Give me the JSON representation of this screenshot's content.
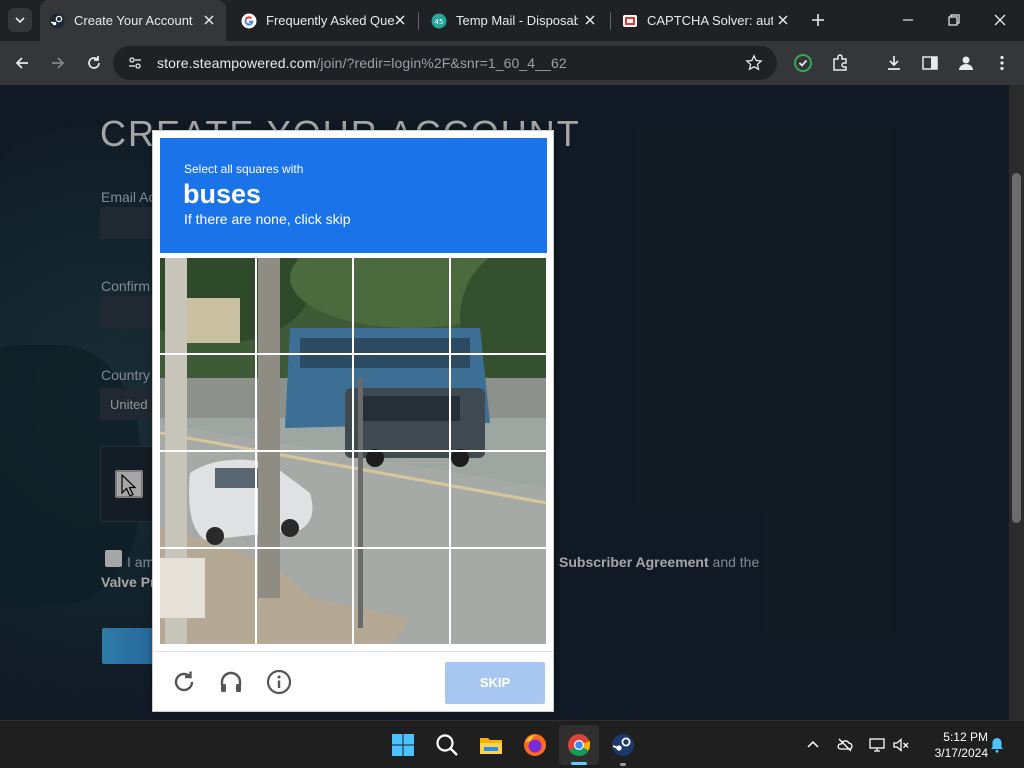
{
  "browser": {
    "tabs": [
      {
        "title": "Create Your Account",
        "favicon": "steam-icon",
        "active": true
      },
      {
        "title": "Frequently Asked Que",
        "favicon": "google-icon",
        "active": false
      },
      {
        "title": "Temp Mail - Disposab",
        "favicon": "tempmail-icon",
        "active": false
      },
      {
        "title": "CAPTCHA Solver: auto",
        "favicon": "captcha-solver-icon",
        "active": false
      }
    ],
    "url_host": "store.steampowered.com",
    "url_path": "/join/?redir=login%2F&snr=1_60_4__62",
    "accent": "#1a73e8"
  },
  "page": {
    "title": "CREATE YOUR ACCOUNT",
    "email_label": "Email Ac",
    "confirm_label": "Confirm",
    "country_label": "Country",
    "country_value": "United",
    "agree_text_start": "I am",
    "agree_link_1": "Subscriber Agreement",
    "agree_text_mid": "and the",
    "agree_line2": "Valve Pr",
    "bg_color": "#1b2838"
  },
  "captcha": {
    "instruction": "Select all squares with",
    "object": "buses",
    "hint": "If there are none, click skip",
    "grid_size": 4,
    "skip_label": "SKIP",
    "footer_icons": [
      "reload-icon",
      "audio-icon",
      "info-icon"
    ]
  },
  "taskbar": {
    "apps": [
      "start-icon",
      "search-icon",
      "file-explorer-icon",
      "firefox-icon",
      "chrome-icon",
      "steam-icon"
    ],
    "time": "5:12 PM",
    "date": "3/17/2024"
  }
}
